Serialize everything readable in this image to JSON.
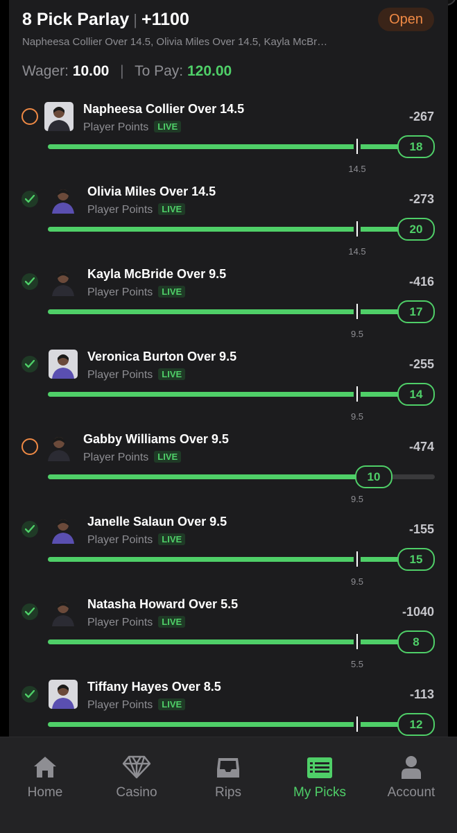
{
  "header": {
    "title": "8 Pick Parlay",
    "sep": "|",
    "odds": "+1100",
    "status_badge": "Open",
    "subtitle": "Napheesa Collier Over 14.5, Olivia Miles Over 14.5, Kayla McBr…"
  },
  "wager": {
    "wager_label": "Wager:",
    "wager_value": "10.00",
    "divider": "|",
    "pay_label": "To Pay:",
    "pay_value": "120.00"
  },
  "picks": [
    {
      "name": "Napheesa Collier Over 14.5",
      "type": "Player Points",
      "live": "LIVE",
      "odds": "-267",
      "line": "14.5",
      "value": "18",
      "status": "open",
      "progress": 1.0
    },
    {
      "name": "Olivia Miles Over 14.5",
      "type": "Player Points",
      "live": "LIVE",
      "odds": "-273",
      "line": "14.5",
      "value": "20",
      "status": "done",
      "progress": 1.0
    },
    {
      "name": "Kayla McBride Over 9.5",
      "type": "Player Points",
      "live": "LIVE",
      "odds": "-416",
      "line": "9.5",
      "value": "17",
      "status": "done",
      "progress": 1.0
    },
    {
      "name": "Veronica Burton Over 9.5",
      "type": "Player Points",
      "live": "LIVE",
      "odds": "-255",
      "line": "9.5",
      "value": "14",
      "status": "done",
      "progress": 1.0
    },
    {
      "name": "Gabby Williams Over 9.5",
      "type": "Player Points",
      "live": "LIVE",
      "odds": "-474",
      "line": "9.5",
      "value": "10",
      "status": "open",
      "progress": 0.85
    },
    {
      "name": "Janelle Salaun Over 9.5",
      "type": "Player Points",
      "live": "LIVE",
      "odds": "-155",
      "line": "9.5",
      "value": "15",
      "status": "done",
      "progress": 1.0
    },
    {
      "name": "Natasha Howard Over 5.5",
      "type": "Player Points",
      "live": "LIVE",
      "odds": "-1040",
      "line": "5.5",
      "value": "8",
      "status": "done",
      "progress": 1.0
    },
    {
      "name": "Tiffany Hayes Over 8.5",
      "type": "Player Points",
      "live": "LIVE",
      "odds": "-113",
      "line": "8.5",
      "value": "12",
      "status": "done",
      "progress": 1.0
    }
  ],
  "nav": {
    "home": "Home",
    "casino": "Casino",
    "rips": "Rips",
    "my_picks": "My Picks",
    "account": "Account"
  },
  "colors": {
    "accent_green": "#4fcf68",
    "open_orange": "#f08a45",
    "card_bg": "#1c1c1e"
  }
}
